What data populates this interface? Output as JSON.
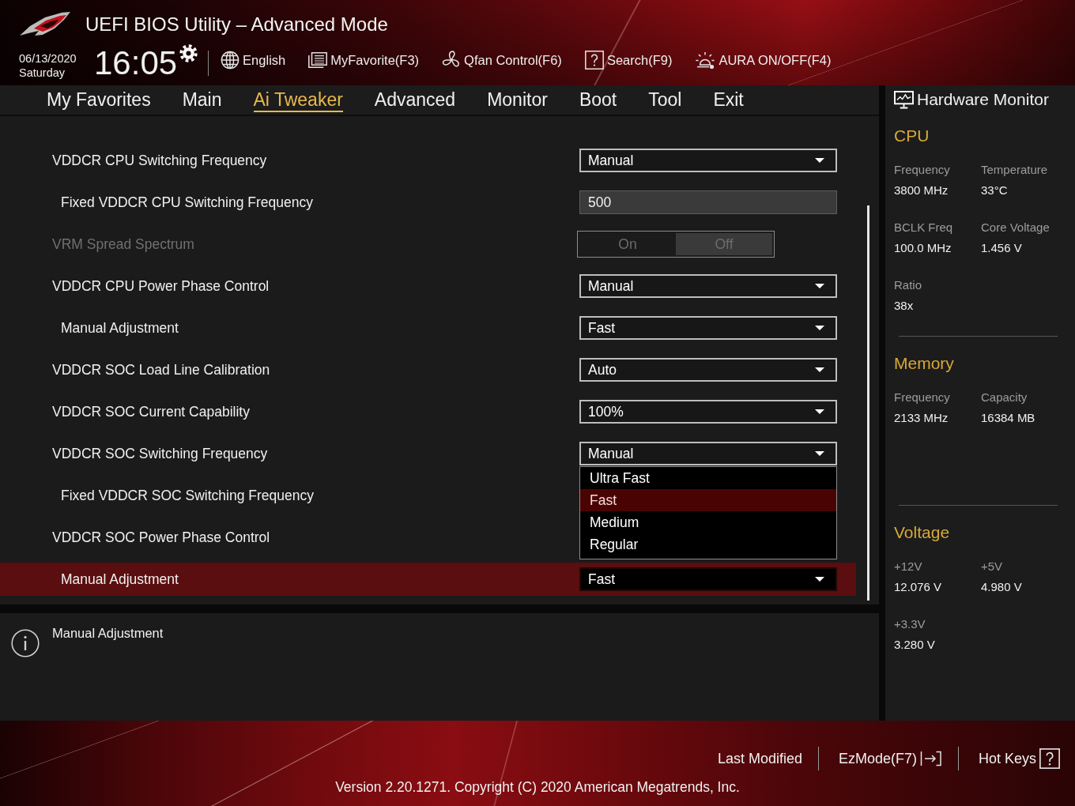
{
  "header": {
    "title": "UEFI BIOS Utility – Advanced Mode",
    "date": "06/13/2020",
    "weekday": "Saturday",
    "time": "16:05",
    "tools": [
      {
        "kind": "language",
        "label": "English"
      },
      {
        "kind": "favorite",
        "label": "MyFavorite(F3)"
      },
      {
        "kind": "fan",
        "label": "Qfan Control(F6)"
      },
      {
        "kind": "search",
        "label": "Search(F9)"
      },
      {
        "kind": "aura",
        "label": "AURA ON/OFF(F4)"
      }
    ]
  },
  "tabs": [
    {
      "label": "My Favorites",
      "selected": false
    },
    {
      "label": "Main",
      "selected": false
    },
    {
      "label": "Ai Tweaker",
      "selected": true
    },
    {
      "label": "Advanced",
      "selected": false
    },
    {
      "label": "Monitor",
      "selected": false
    },
    {
      "label": "Boot",
      "selected": false
    },
    {
      "label": "Tool",
      "selected": false
    },
    {
      "label": "Exit",
      "selected": false
    }
  ],
  "settings": [
    {
      "label": "VDDCR CPU Switching Frequency",
      "disabled": false,
      "selected": false,
      "control": {
        "kind": "dropdown",
        "value": "Manual"
      },
      "children": [
        {
          "label": "Fixed VDDCR CPU Switching Frequency",
          "disabled": false,
          "selected": false,
          "control": {
            "kind": "number",
            "value": "500"
          }
        }
      ]
    },
    {
      "label": "VRM Spread Spectrum",
      "disabled": true,
      "selected": false,
      "control": {
        "kind": "toggle",
        "options": [
          {
            "label": "On",
            "selected": false
          },
          {
            "label": "Off",
            "selected": true
          }
        ]
      }
    },
    {
      "label": "VDDCR CPU Power Phase Control",
      "disabled": false,
      "selected": false,
      "control": {
        "kind": "dropdown",
        "value": "Manual"
      },
      "children": [
        {
          "label": "Manual Adjustment",
          "disabled": false,
          "selected": false,
          "control": {
            "kind": "dropdown",
            "value": "Fast"
          }
        }
      ]
    },
    {
      "label": "VDDCR SOC Load Line Calibration",
      "disabled": false,
      "selected": false,
      "control": {
        "kind": "dropdown",
        "value": "Auto"
      }
    },
    {
      "label": "VDDCR SOC Current Capability",
      "disabled": false,
      "selected": false,
      "control": {
        "kind": "dropdown",
        "value": "100%"
      }
    },
    {
      "label": "VDDCR SOC Switching Frequency",
      "disabled": false,
      "selected": false,
      "control": {
        "kind": "dropdown",
        "value": "Manual"
      },
      "children": [
        {
          "label": "Fixed VDDCR SOC Switching Frequency",
          "disabled": false,
          "selected": false
        }
      ]
    },
    {
      "label": "VDDCR SOC Power Phase Control",
      "disabled": false,
      "selected": false,
      "children": [
        {
          "label": "Manual Adjustment",
          "disabled": false,
          "selected": true,
          "control": {
            "kind": "dropdown",
            "value": "Fast",
            "expanded": true,
            "options": [
              {
                "label": "Ultra Fast",
                "selected": false
              },
              {
                "label": "Fast",
                "selected": true
              },
              {
                "label": "Medium",
                "selected": false
              },
              {
                "label": "Regular",
                "selected": false
              }
            ]
          }
        }
      ]
    }
  ],
  "help": {
    "text": "Manual Adjustment"
  },
  "hardware_monitor": {
    "title": "Hardware Monitor",
    "sections": [
      {
        "title": "CPU",
        "items": [
          {
            "label": "Frequency",
            "value": "3800 MHz"
          },
          {
            "label": "Temperature",
            "value": "33°C"
          },
          {
            "label": "BCLK Freq",
            "value": "100.0 MHz"
          },
          {
            "label": "Core Voltage",
            "value": "1.456 V"
          },
          {
            "label": "Ratio",
            "value": "38x"
          }
        ]
      },
      {
        "title": "Memory",
        "items": [
          {
            "label": "Frequency",
            "value": "2133 MHz"
          },
          {
            "label": "Capacity",
            "value": "16384 MB"
          }
        ]
      },
      {
        "title": "Voltage",
        "items": [
          {
            "label": "+12V",
            "value": "12.076 V"
          },
          {
            "label": "+5V",
            "value": "4.980 V"
          },
          {
            "label": "+3.3V",
            "value": "3.280 V"
          }
        ]
      }
    ]
  },
  "footer": {
    "actions": [
      {
        "kind": "last_modified",
        "label": "Last Modified"
      },
      {
        "kind": "ezmode",
        "label": "EzMode(F7)"
      },
      {
        "kind": "hotkeys",
        "label": "Hot Keys"
      }
    ],
    "version": "Version 2.20.1271. Copyright (C) 2020 American Megatrends, Inc."
  }
}
